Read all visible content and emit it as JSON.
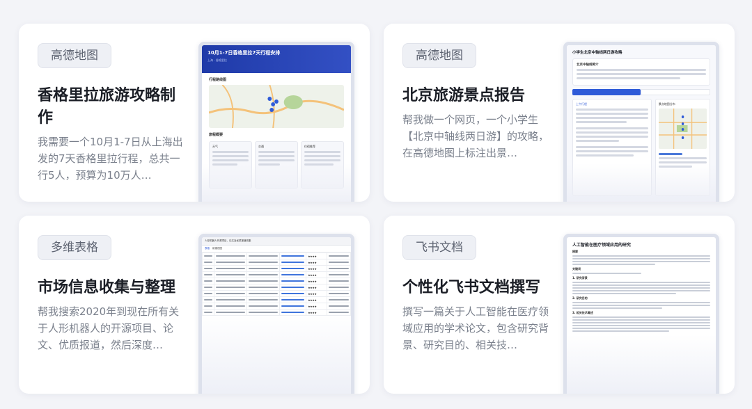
{
  "cards": [
    {
      "tag": "高德地图",
      "title": "香格里拉旅游攻略制作",
      "description": "我需要一个10月1-7日从上海出发的7天香格里拉行程，总共一行5人，预算为10万人…",
      "preview": {
        "title": "10月1-7日香格里拉7天行程安排",
        "subtitle": "上海 · 香格里拉",
        "section_label": "行程路线图",
        "overview_label": "旅程概要",
        "columns": [
          "天气",
          "交通",
          "住宿推荐"
        ]
      }
    },
    {
      "tag": "高德地图",
      "title": "北京旅游景点报告",
      "description": "帮我做一个网页，一个小学生【北京中轴线两日游】的攻略，在高德地图上标注出景…",
      "preview": {
        "title": "小学生北京中轴线两日游攻略",
        "panel_label": "北京中轴线简介",
        "tab_a": "第一天行程",
        "tab_b": "第二天行程",
        "left_label": "上午行程",
        "right_label": "景点地图分布"
      }
    },
    {
      "tag": "多维表格",
      "title": "市场信息收集与整理",
      "description": "帮我搜索2020年到现在所有关于人形机器人的开源项目、论文、优质报道，然后深度…",
      "preview": {
        "sheet_title": "人形机器人开源项目、论文及优质报道收集",
        "toolbar": [
          "表格",
          "新建视图"
        ],
        "stars": "★★★★"
      }
    },
    {
      "tag": "飞书文档",
      "title": "个性化飞书文档撰写",
      "description": "撰写一篇关于人工智能在医疗领域应用的学术论文，包含研究背景、研究目的、相关技…",
      "preview": {
        "title": "人工智能在医疗领域应用的研究",
        "headings": [
          "摘要",
          "关键词",
          "1. 研究背景",
          "2. 研究目的",
          "3. 相关技术概述"
        ]
      }
    }
  ],
  "colors": {
    "page_bg": "#f3f4f8",
    "card_bg": "#ffffff",
    "tag_bg": "#eef0f5",
    "title": "#1b1e26",
    "desc": "#7a808c",
    "accent_blue": "#2f5bd8"
  }
}
